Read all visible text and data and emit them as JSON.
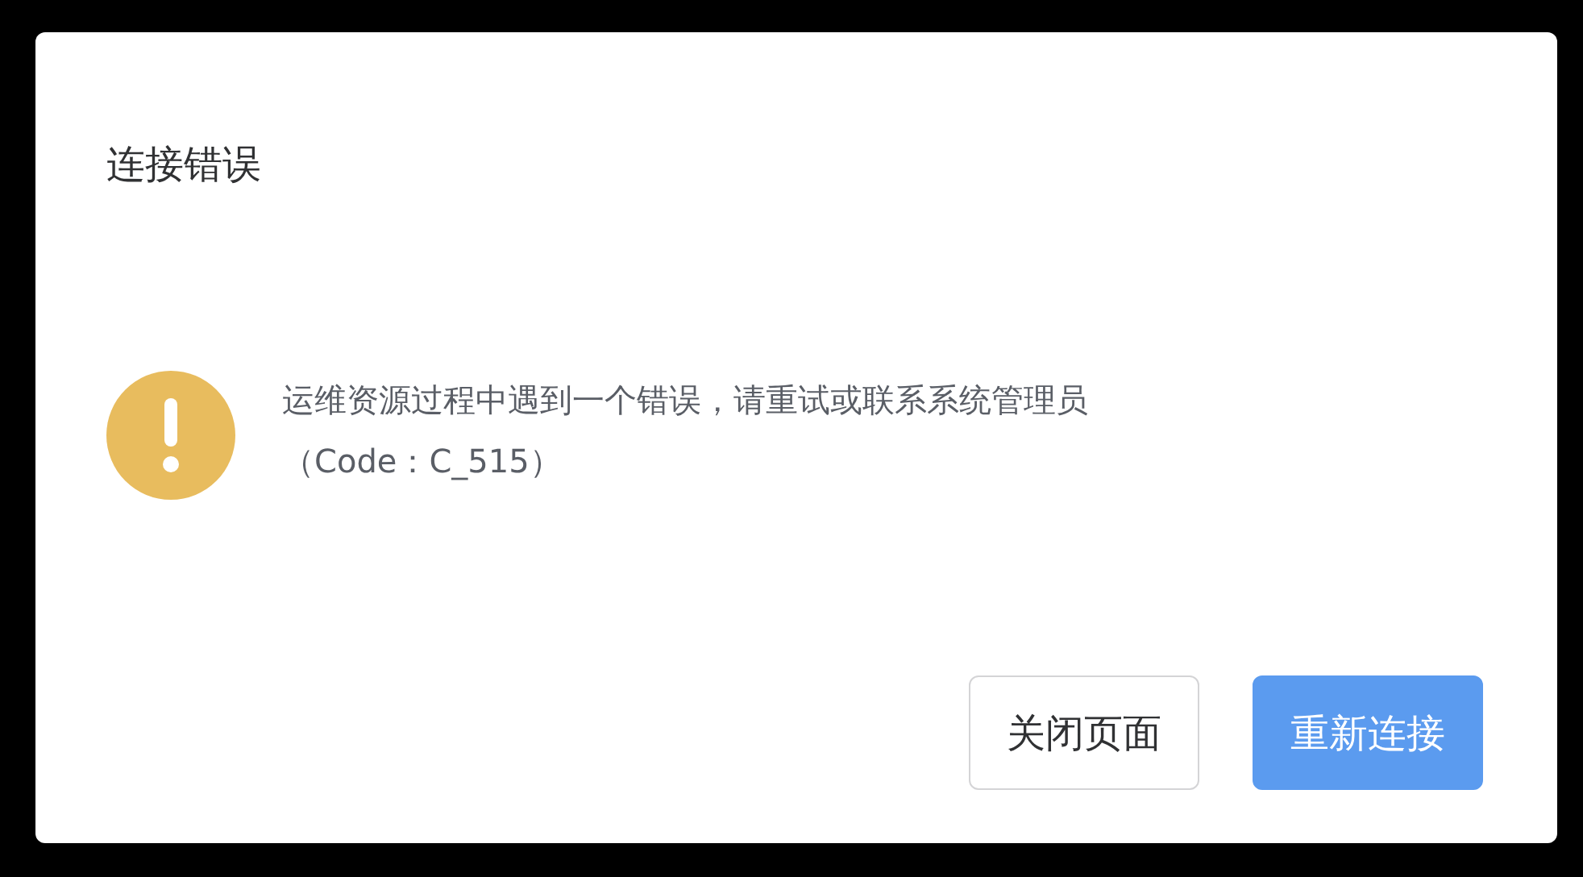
{
  "dialog": {
    "title": "连接错误",
    "message": "运维资源过程中遇到一个错误，请重试或联系系统管理员",
    "code": "（Code：C_515）",
    "buttons": [
      {
        "label": "关闭页面",
        "kind": "default"
      },
      {
        "label": "重新连接",
        "kind": "primary"
      }
    ]
  }
}
